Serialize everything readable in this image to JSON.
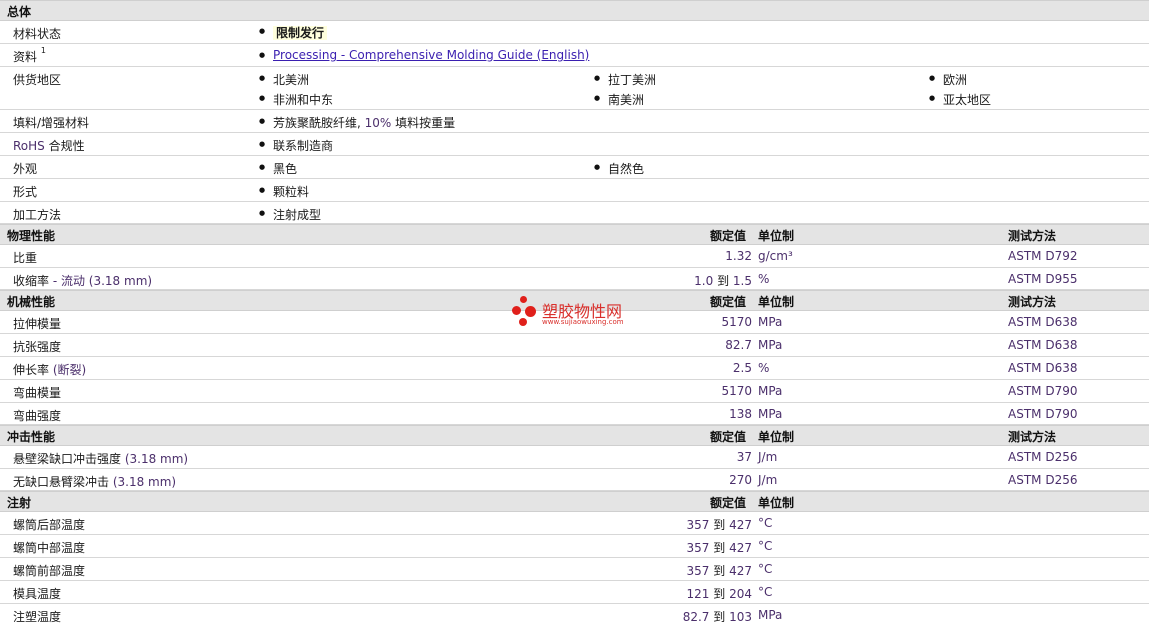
{
  "general": {
    "title": "总体",
    "material_status": {
      "label": "材料状态",
      "value": "限制发行"
    },
    "literature": {
      "label": "资料",
      "sup": "1",
      "link": "Processing - Comprehensive Molding Guide (English)"
    },
    "regions": {
      "label": "供货地区",
      "items": [
        "北美洲",
        "拉丁美洲",
        "欧洲",
        "非洲和中东",
        "南美洲",
        "亚太地区"
      ]
    },
    "filler": {
      "label": "填料/增强材料",
      "value_prefix": "芳族聚酰胺纤维, ",
      "value_num": "10%",
      "value_suffix": " 填料按重量"
    },
    "rohs": {
      "label_a": "RoHS",
      "label_b": " 合规性",
      "value": "联系制造商"
    },
    "appearance": {
      "label": "外观",
      "items": [
        "黑色",
        "自然色"
      ]
    },
    "form": {
      "label": "形式",
      "value": "颗粒料"
    },
    "processing": {
      "label": "加工方法",
      "value": "注射成型"
    }
  },
  "headers": {
    "nominal": "额定值",
    "unit": "单位制",
    "method": "测试方法"
  },
  "physical": {
    "title": "物理性能",
    "rows": [
      {
        "label": "比重",
        "cond": "",
        "v1": "1.32",
        "to": "",
        "v2": "",
        "unit": "g/cm³",
        "method": "ASTM D792"
      },
      {
        "label": "收缩率 ",
        "cond": "- 流动  (3.18 mm)",
        "v1": "1.0",
        "to": "到",
        "v2": "1.5",
        "unit": "%",
        "method": "ASTM D955"
      }
    ]
  },
  "mechanical": {
    "title": "机械性能",
    "rows": [
      {
        "label": "拉伸模量",
        "cond": "",
        "v1": "5170",
        "unit": "MPa",
        "method": "ASTM D638"
      },
      {
        "label": "抗张强度",
        "cond": "",
        "v1": "82.7",
        "unit": "MPa",
        "method": "ASTM D638"
      },
      {
        "label": "伸长率 ",
        "cond": "(断裂)",
        "v1": "2.5",
        "unit": "%",
        "method": "ASTM D638"
      },
      {
        "label": "弯曲模量",
        "cond": "",
        "v1": "5170",
        "unit": "MPa",
        "method": "ASTM D790"
      },
      {
        "label": "弯曲强度",
        "cond": "",
        "v1": "138",
        "unit": "MPa",
        "method": "ASTM D790"
      }
    ]
  },
  "impact": {
    "title": "冲击性能",
    "rows": [
      {
        "label": "悬壁梁缺口冲击强度 ",
        "cond": "(3.18 mm)",
        "v1": "37",
        "unit": "J/m",
        "method": "ASTM D256"
      },
      {
        "label": "无缺口悬臂梁冲击 ",
        "cond": "(3.18 mm)",
        "v1": "270",
        "unit": "J/m",
        "method": "ASTM D256"
      }
    ]
  },
  "injection": {
    "title": "注射",
    "rows": [
      {
        "label": "螺筒后部温度",
        "v1": "357",
        "to": "到",
        "v2": "427",
        "unit": "°C"
      },
      {
        "label": "螺筒中部温度",
        "v1": "357",
        "to": "到",
        "v2": "427",
        "unit": "°C"
      },
      {
        "label": "螺筒前部温度",
        "v1": "357",
        "to": "到",
        "v2": "427",
        "unit": "°C"
      },
      {
        "label": "模具温度",
        "v1": "121",
        "to": "到",
        "v2": "204",
        "unit": "°C"
      },
      {
        "label": "注塑温度",
        "v1": "82.7",
        "to": "到",
        "v2": "103",
        "unit": "MPa"
      }
    ]
  },
  "watermark": {
    "cn": "塑胶物性网",
    "en": "www.sujiaowuxing.com"
  }
}
